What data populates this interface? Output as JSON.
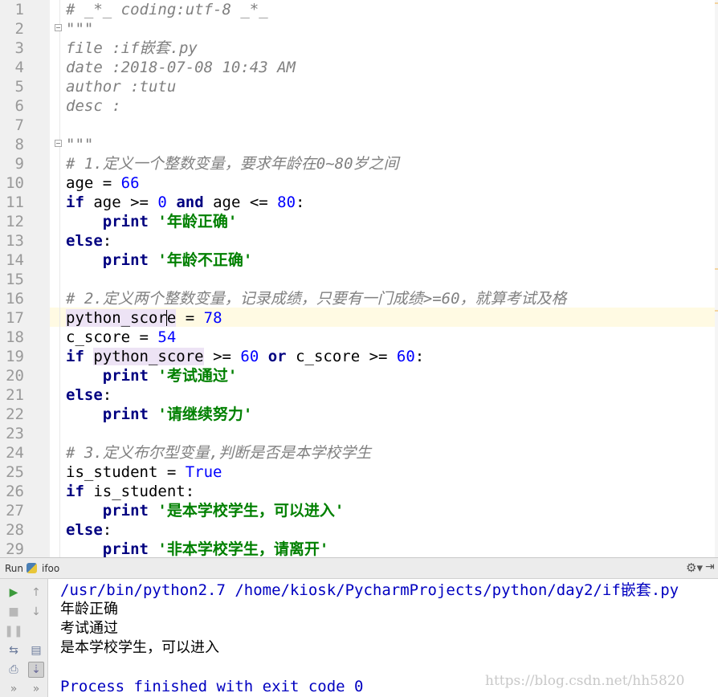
{
  "editor": {
    "filename": "if嵌套.py",
    "current_line": 17,
    "lines": [
      [
        {
          "t": "# _*_ coding:utf-8 _*_",
          "c": "cm"
        }
      ],
      [
        {
          "t": "\"\"\"",
          "c": "cm"
        }
      ],
      [
        {
          "t": "file :if嵌套.py",
          "c": "cm"
        }
      ],
      [
        {
          "t": "date :2018-07-08 10:43 AM",
          "c": "cm"
        }
      ],
      [
        {
          "t": "author :tutu",
          "c": "cm"
        }
      ],
      [
        {
          "t": "desc :",
          "c": "cm"
        }
      ],
      [],
      [
        {
          "t": "\"\"\"",
          "c": "cm"
        }
      ],
      [
        {
          "t": "# 1.定义一个整数变量，要求年龄在0~80岁之间",
          "c": "cm"
        }
      ],
      [
        {
          "t": "age = ",
          "c": "plain"
        },
        {
          "t": "66",
          "c": "num"
        }
      ],
      [
        {
          "t": "if",
          "c": "kw"
        },
        {
          "t": " age >= ",
          "c": "plain"
        },
        {
          "t": "0",
          "c": "num"
        },
        {
          "t": " ",
          "c": "plain"
        },
        {
          "t": "and",
          "c": "kw"
        },
        {
          "t": " age <= ",
          "c": "plain"
        },
        {
          "t": "80",
          "c": "num"
        },
        {
          "t": ":",
          "c": "plain"
        }
      ],
      [
        {
          "t": "    ",
          "c": "plain"
        },
        {
          "t": "print",
          "c": "kw"
        },
        {
          "t": " ",
          "c": "plain"
        },
        {
          "t": "'年龄正确'",
          "c": "str"
        }
      ],
      [
        {
          "t": "else",
          "c": "kw"
        },
        {
          "t": ":",
          "c": "plain"
        }
      ],
      [
        {
          "t": "    ",
          "c": "plain"
        },
        {
          "t": "print",
          "c": "kw"
        },
        {
          "t": " ",
          "c": "plain"
        },
        {
          "t": "'年龄不正确'",
          "c": "str"
        }
      ],
      [],
      [
        {
          "t": "# 2.定义两个整数变量，记录成绩，只要有一门成绩>=60，就算考试及格",
          "c": "cm"
        }
      ],
      [
        {
          "t": "python_scor",
          "c": "plain hl"
        },
        {
          "t": "",
          "c": "caret"
        },
        {
          "t": "e",
          "c": "plain hl"
        },
        {
          "t": " = ",
          "c": "plain"
        },
        {
          "t": "78",
          "c": "num"
        }
      ],
      [
        {
          "t": "c_score = ",
          "c": "plain"
        },
        {
          "t": "54",
          "c": "num"
        }
      ],
      [
        {
          "t": "if",
          "c": "kw"
        },
        {
          "t": " ",
          "c": "plain"
        },
        {
          "t": "python_score",
          "c": "plain hl"
        },
        {
          "t": " >= ",
          "c": "plain"
        },
        {
          "t": "60",
          "c": "num"
        },
        {
          "t": " ",
          "c": "plain"
        },
        {
          "t": "or",
          "c": "kw"
        },
        {
          "t": " c_score >= ",
          "c": "plain"
        },
        {
          "t": "60",
          "c": "num"
        },
        {
          "t": ":",
          "c": "plain"
        }
      ],
      [
        {
          "t": "    ",
          "c": "plain"
        },
        {
          "t": "print",
          "c": "kw"
        },
        {
          "t": " ",
          "c": "plain"
        },
        {
          "t": "'考试通过'",
          "c": "str"
        }
      ],
      [
        {
          "t": "else",
          "c": "kw"
        },
        {
          "t": ":",
          "c": "plain"
        }
      ],
      [
        {
          "t": "    ",
          "c": "plain"
        },
        {
          "t": "print",
          "c": "kw"
        },
        {
          "t": " ",
          "c": "plain"
        },
        {
          "t": "'请继续努力'",
          "c": "str"
        }
      ],
      [],
      [
        {
          "t": "# 3.定义布尔型变量,判断是否是本学校学生",
          "c": "cm"
        }
      ],
      [
        {
          "t": "is_student = ",
          "c": "plain"
        },
        {
          "t": "True",
          "c": "num"
        }
      ],
      [
        {
          "t": "if",
          "c": "kw"
        },
        {
          "t": " is_student:",
          "c": "plain"
        }
      ],
      [
        {
          "t": "    ",
          "c": "plain"
        },
        {
          "t": "print",
          "c": "kw"
        },
        {
          "t": " ",
          "c": "plain"
        },
        {
          "t": "'是本学校学生，可以进入'",
          "c": "str"
        }
      ],
      [
        {
          "t": "else",
          "c": "kw"
        },
        {
          "t": ":",
          "c": "plain"
        }
      ],
      [
        {
          "t": "    ",
          "c": "plain"
        },
        {
          "t": "print",
          "c": "kw"
        },
        {
          "t": " ",
          "c": "plain"
        },
        {
          "t": "'非本学校学生，请离开'",
          "c": "str"
        }
      ]
    ]
  },
  "run_panel": {
    "label": "Run",
    "config_name": "ifoo",
    "gear_icon": "gear-icon",
    "minimize_icon": "minimize-icon",
    "command": "/usr/bin/python2.7 /home/kiosk/PycharmProjects/python/day2/if嵌套.py",
    "output": [
      "年龄正确",
      "考试通过",
      "是本学校学生，可以进入"
    ],
    "exit_message": "Process finished with exit code 0",
    "watermark": "https://blog.csdn.net/hh5820"
  },
  "toolbar": [
    {
      "name": "rerun-icon",
      "glyph": "▶",
      "color": "#3c9a3c"
    },
    {
      "name": "up-arrow-icon",
      "glyph": "↑",
      "color": "#9a9a9a"
    },
    {
      "name": "stop-icon",
      "glyph": "■",
      "color": "#b8b8b8"
    },
    {
      "name": "down-arrow-icon",
      "glyph": "↓",
      "color": "#9a9a9a"
    },
    {
      "name": "pause-icon",
      "glyph": "❚❚",
      "color": "#b8b8b8"
    },
    {
      "name": "soft-wrap-icon",
      "glyph": "⇆",
      "color": "#6a7a9a"
    },
    {
      "name": "scroll-to-end-icon",
      "glyph": "⇣",
      "color": "#6a6a9a"
    },
    {
      "name": "layout-icon",
      "glyph": "▤",
      "color": "#6a7a9a"
    },
    {
      "name": "print-icon",
      "glyph": "⎙",
      "color": "#6a7a9a"
    },
    {
      "name": "more-icon",
      "glyph": "»",
      "color": "#8a8a8a"
    },
    {
      "name": "more-icon-2",
      "glyph": "»",
      "color": "#8a8a8a"
    }
  ]
}
